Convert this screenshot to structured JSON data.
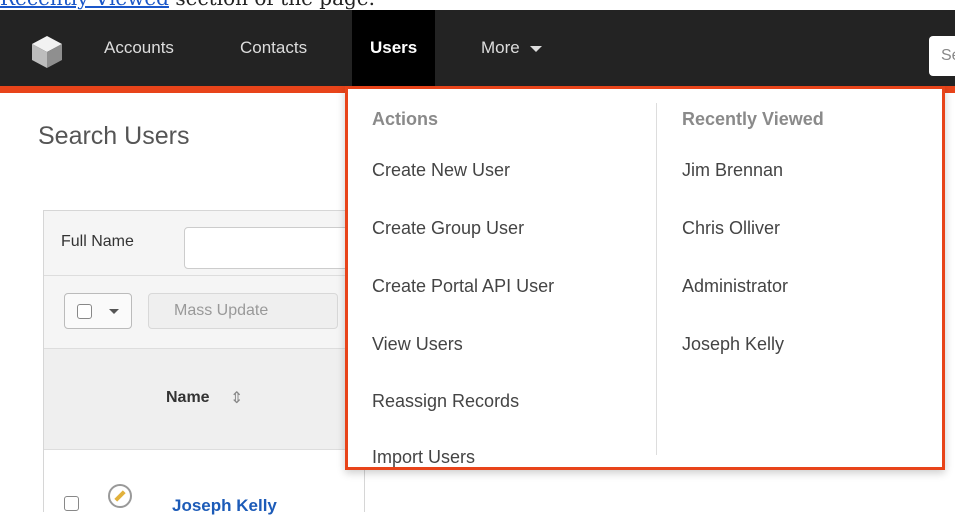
{
  "doc_strip": {
    "text_link": "Recently Viewed",
    "text_rest": " section of the page."
  },
  "navbar": {
    "items": [
      {
        "label": "Accounts"
      },
      {
        "label": "Contacts"
      },
      {
        "label": "Users",
        "active": true
      },
      {
        "label": "More"
      }
    ],
    "search_placeholder": "Sea"
  },
  "page": {
    "title": "Search Users",
    "filter_label": "Full Name",
    "mass_update_label": "Mass Update",
    "column_name": "Name",
    "rows": [
      {
        "name": "Joseph Kelly"
      }
    ]
  },
  "menu": {
    "actions_heading": "Actions",
    "actions": [
      "Create New User",
      "Create Group User",
      "Create Portal API User",
      "View Users",
      "Reassign Records",
      "Import Users"
    ],
    "recent_heading": "Recently Viewed",
    "recent": [
      "Jim Brennan",
      "Chris Olliver",
      "Administrator",
      "Joseph Kelly"
    ]
  },
  "colors": {
    "accent": "#e8441a",
    "navbar": "#232323",
    "link": "#1c5bb8"
  },
  "icons": [
    "sugar-cube-logo-icon",
    "chevron-down-icon",
    "sort-icon",
    "edit-pencil-icon"
  ]
}
